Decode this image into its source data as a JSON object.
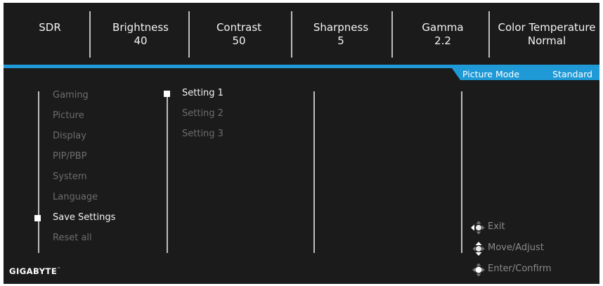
{
  "status_bar": [
    {
      "label": "SDR",
      "value": ""
    },
    {
      "label": "Brightness",
      "value": "40"
    },
    {
      "label": "Contrast",
      "value": "50"
    },
    {
      "label": "Sharpness",
      "value": "5"
    },
    {
      "label": "Gamma",
      "value": "2.2"
    },
    {
      "label": "Color Temperature",
      "value": "Normal"
    }
  ],
  "picture_mode": {
    "label": "Picture Mode",
    "value": "Standard"
  },
  "menu": {
    "items": [
      "Gaming",
      "Picture",
      "Display",
      "PIP/PBP",
      "System",
      "Language",
      "Save Settings",
      "Reset all"
    ],
    "selected": "Save Settings"
  },
  "submenu": {
    "items": [
      "Setting 1",
      "Setting 2",
      "Setting 3"
    ],
    "selected": "Setting 1"
  },
  "hints": [
    {
      "icon": "joystick-left-icon",
      "text": "Exit"
    },
    {
      "icon": "joystick-updown-icon",
      "text": "Move/Adjust"
    },
    {
      "icon": "joystick-press-icon",
      "text": "Enter/Confirm"
    }
  ],
  "brand": {
    "logo": "GIGABYTE",
    "trademark": "™"
  },
  "colors": {
    "accent": "#1f9ad7",
    "background": "#1b1b1b",
    "inactive_text": "#6d6d6d",
    "active_text": "#f4f4f4"
  }
}
